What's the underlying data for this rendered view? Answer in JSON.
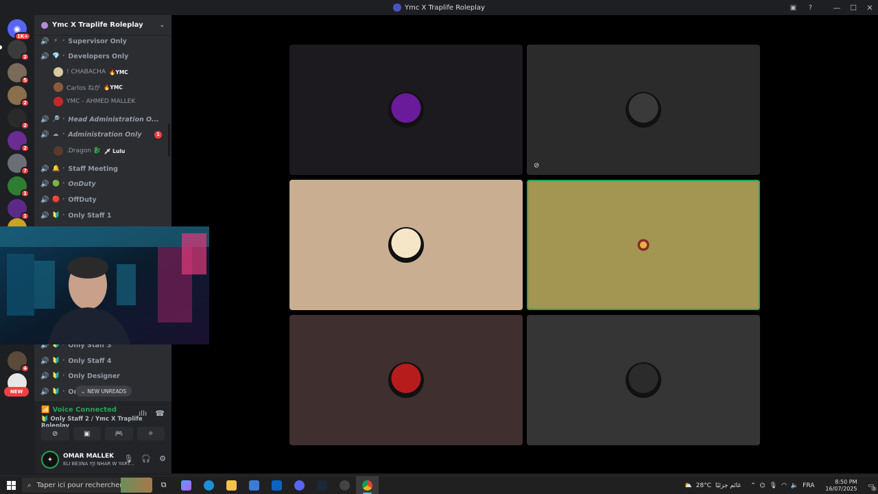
{
  "window": {
    "title": "Ymc X Traplife Roleplay"
  },
  "rail": {
    "home_badge": "1K+",
    "servers": [
      {
        "badge": "2",
        "color": "#3b3b3b"
      },
      {
        "badge": "5",
        "color": "#7a6a5a"
      },
      {
        "badge": "2",
        "color": "#8a6f4c"
      },
      {
        "badge": "2",
        "color": "#2a2a2a"
      },
      {
        "badge": "2",
        "color": "#6a2c91"
      },
      {
        "badge": "7",
        "color": "#6b6f75"
      },
      {
        "badge": "1",
        "color": "#2e7d32"
      },
      {
        "badge": "1",
        "color": "#5b2a86"
      },
      {
        "badge": "",
        "color": "#c9a227"
      },
      {
        "badge": "4",
        "color": "#5a4a3a"
      },
      {
        "badge": "",
        "color": "#e6e6e6"
      }
    ],
    "new_label": "NEW"
  },
  "sidebar": {
    "server_name": "Ymc X Traplife Roleplay",
    "channels": [
      {
        "emoji": "⚡",
        "name": "Supervisor Only",
        "italic": false,
        "badge": ""
      },
      {
        "emoji": "💎",
        "name": "Developers Only",
        "italic": false,
        "badge": ""
      },
      {
        "emoji": "🔎",
        "name": "Head Administration O...",
        "italic": true,
        "badge": ""
      },
      {
        "emoji": "☁",
        "name": "Administration Only",
        "italic": true,
        "badge": "1"
      },
      {
        "emoji": "🔔",
        "name": "Staff Meeting",
        "italic": false,
        "badge": ""
      },
      {
        "emoji": "🟢",
        "name": "OnDuty",
        "italic": true,
        "badge": ""
      },
      {
        "emoji": "🔴",
        "name": "OffDuty",
        "italic": false,
        "badge": ""
      },
      {
        "emoji": "🔰",
        "name": "Only Staff 1",
        "italic": false,
        "badge": ""
      },
      {
        "emoji": "🔰",
        "name": "Only Staff 3",
        "italic": false,
        "badge": ""
      },
      {
        "emoji": "🔰",
        "name": "Only Staff 4",
        "italic": false,
        "badge": ""
      },
      {
        "emoji": "🔰",
        "name": "Only Designer",
        "italic": false,
        "badge": ""
      },
      {
        "emoji": "🔰",
        "name": "On",
        "italic": false,
        "badge": ""
      }
    ],
    "members": [
      {
        "name": "! CHABACHA",
        "tag": "🔥YMC",
        "color": "#d7c9a0"
      },
      {
        "name": "Carlos ねが",
        "tag": "🔥YMC",
        "color": "#8a5a3a"
      },
      {
        "name": "YMC - AHMED MALLEK",
        "tag": "",
        "color": "#c62828"
      },
      {
        "name": ".Dragon 🐉",
        "tag": "🗡 Lulu",
        "color": "#5a3a2a"
      }
    ],
    "new_unreads": "NEW UNREADS"
  },
  "voice": {
    "status": "Voice Connected",
    "channel": "Only Staff 2 / Ymc X Traplife Roleplay"
  },
  "user": {
    "name": "OMAR MALLEK",
    "status": "ELI BE3NA YJI NHAR W YART..."
  },
  "tiles": [
    {
      "bg": "#1c191f",
      "avatar": "#6a1b9a",
      "speaking": false,
      "muted": false
    },
    {
      "bg": "#2b2b2b",
      "avatar": "#3a3a3a",
      "speaking": false,
      "muted": true
    },
    {
      "bg": "#c9ae92",
      "avatar": "#f5e6c8",
      "speaking": false,
      "muted": false
    },
    {
      "bg": "#a39552",
      "avatar": "#a39552",
      "speaking": true,
      "muted": false
    },
    {
      "bg": "#3f2f2f",
      "avatar": "#b71c1c",
      "speaking": false,
      "muted": false
    },
    {
      "bg": "#353535",
      "avatar": "#2b2b2b",
      "speaking": false,
      "muted": false
    }
  ],
  "taskbar": {
    "search_placeholder": "Taper ici pour rechercher",
    "weather": "28°C",
    "weather_text": "غائم جزئيًا",
    "lang": "FRA",
    "time": "8:50 PM",
    "date": "16/07/2025",
    "notif_count": "3"
  }
}
